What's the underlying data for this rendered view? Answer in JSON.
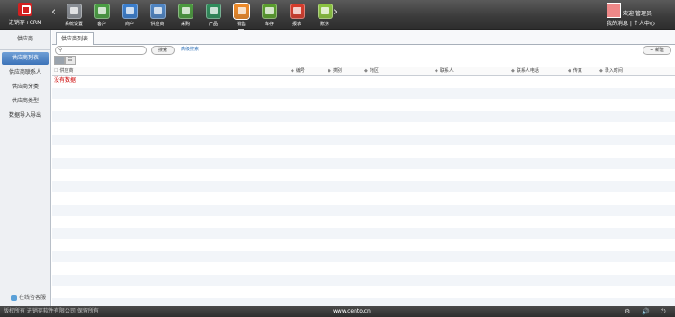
{
  "app": {
    "logo_text": "进销存+CRM",
    "nav_prev_glyph": "‹",
    "nav_next_glyph": "›"
  },
  "modules": [
    {
      "label": "系统设置",
      "icon": "gear-icon",
      "color": "#8a8f96"
    },
    {
      "label": "客户",
      "icon": "customer-icon",
      "color": "#4aa043"
    },
    {
      "label": "商户",
      "icon": "merchant-icon",
      "color": "#3a7fd0"
    },
    {
      "label": "供应商",
      "icon": "supplier-icon",
      "color": "#4f86c6"
    },
    {
      "label": "采购",
      "icon": "purchase-icon",
      "color": "#4b9b3e"
    },
    {
      "label": "产品",
      "icon": "product-icon",
      "color": "#2f8f5c"
    },
    {
      "label": "销售",
      "icon": "sales-icon",
      "color": "#f28c28",
      "active": true
    },
    {
      "label": "库存",
      "icon": "inventory-icon",
      "color": "#5aa02c"
    },
    {
      "label": "报表",
      "icon": "report-icon",
      "color": "#d93b2b"
    },
    {
      "label": "账务",
      "icon": "finance-icon",
      "color": "#8cc63f"
    }
  ],
  "user": {
    "name": "管理员",
    "prefix": "欢迎",
    "personal_center": "我的消息 | 个人中心"
  },
  "sidebar": {
    "header": "供应商",
    "items": [
      {
        "label": "供应商列表",
        "active": true
      },
      {
        "label": "供应商联系人"
      },
      {
        "label": "供应商分类"
      },
      {
        "label": "供应商类型"
      },
      {
        "label": "数据导入导出"
      }
    ],
    "help": "在线咨客服"
  },
  "main": {
    "tab": "供应商列表",
    "search_placeholder": "",
    "search_button": "搜索",
    "advanced_link": "高级搜索",
    "new_button": "+ 新建",
    "view_buttons": [
      "",
      "☷"
    ],
    "columns": [
      "供应商",
      "编号",
      "类别",
      "地区",
      "联系人",
      "联系人电话",
      "传真",
      "录入时间"
    ],
    "empty_text": "没有数据"
  },
  "footer": {
    "copyright": "版权所有 进销存软件有限公司 保留所有",
    "site": "www.cento.cn"
  }
}
